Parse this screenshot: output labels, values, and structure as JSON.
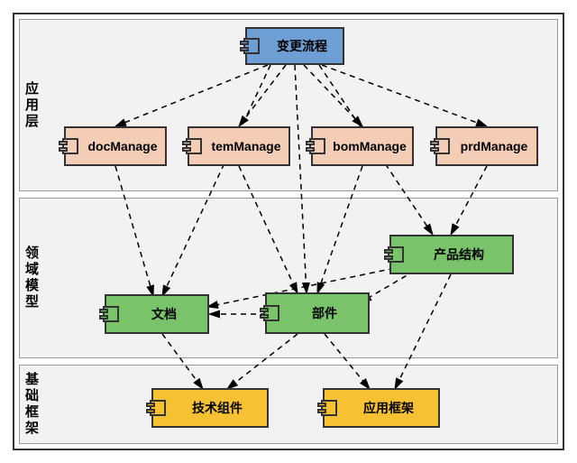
{
  "layers": {
    "app": {
      "title": "应用层"
    },
    "domain": {
      "title": "领域模型"
    },
    "infra": {
      "title": "基础框架"
    }
  },
  "components": {
    "change": {
      "label": "变更流程"
    },
    "docManage": {
      "label": "docManage"
    },
    "temManage": {
      "label": "temManage"
    },
    "bomManage": {
      "label": "bomManage"
    },
    "prdManage": {
      "label": "prdManage"
    },
    "product": {
      "label": "产品结构"
    },
    "doc": {
      "label": "文档"
    },
    "part": {
      "label": "部件"
    },
    "tech": {
      "label": "技术组件"
    },
    "appfw": {
      "label": "应用框架"
    }
  },
  "chart_data": {
    "type": "diagram",
    "title": "",
    "layers": [
      {
        "id": "app",
        "name": "应用层",
        "components": [
          "change",
          "docManage",
          "temManage",
          "bomManage",
          "prdManage"
        ]
      },
      {
        "id": "domain",
        "name": "领域模型",
        "components": [
          "product",
          "doc",
          "part"
        ]
      },
      {
        "id": "infra",
        "name": "基础框架",
        "components": [
          "tech",
          "appfw"
        ]
      }
    ],
    "nodes": [
      {
        "id": "change",
        "label": "变更流程",
        "layer": "app",
        "color": "blue"
      },
      {
        "id": "docManage",
        "label": "docManage",
        "layer": "app",
        "color": "peach"
      },
      {
        "id": "temManage",
        "label": "temManage",
        "layer": "app",
        "color": "peach"
      },
      {
        "id": "bomManage",
        "label": "bomManage",
        "layer": "app",
        "color": "peach"
      },
      {
        "id": "prdManage",
        "label": "prdManage",
        "layer": "app",
        "color": "peach"
      },
      {
        "id": "product",
        "label": "产品结构",
        "layer": "domain",
        "color": "green"
      },
      {
        "id": "doc",
        "label": "文档",
        "layer": "domain",
        "color": "green"
      },
      {
        "id": "part",
        "label": "部件",
        "layer": "domain",
        "color": "green"
      },
      {
        "id": "tech",
        "label": "技术组件",
        "layer": "infra",
        "color": "yellow"
      },
      {
        "id": "appfw",
        "label": "应用框架",
        "layer": "infra",
        "color": "yellow"
      }
    ],
    "edges": [
      {
        "from": "change",
        "to": "docManage"
      },
      {
        "from": "change",
        "to": "temManage"
      },
      {
        "from": "change",
        "to": "bomManage"
      },
      {
        "from": "change",
        "to": "prdManage"
      },
      {
        "from": "change",
        "to": "doc"
      },
      {
        "from": "change",
        "to": "part"
      },
      {
        "from": "change",
        "to": "product"
      },
      {
        "from": "docManage",
        "to": "doc"
      },
      {
        "from": "temManage",
        "to": "part"
      },
      {
        "from": "bomManage",
        "to": "part"
      },
      {
        "from": "prdManage",
        "to": "product"
      },
      {
        "from": "product",
        "to": "part"
      },
      {
        "from": "product",
        "to": "doc"
      },
      {
        "from": "part",
        "to": "doc"
      },
      {
        "from": "doc",
        "to": "tech"
      },
      {
        "from": "part",
        "to": "tech"
      },
      {
        "from": "part",
        "to": "appfw"
      },
      {
        "from": "product",
        "to": "appfw"
      }
    ]
  }
}
